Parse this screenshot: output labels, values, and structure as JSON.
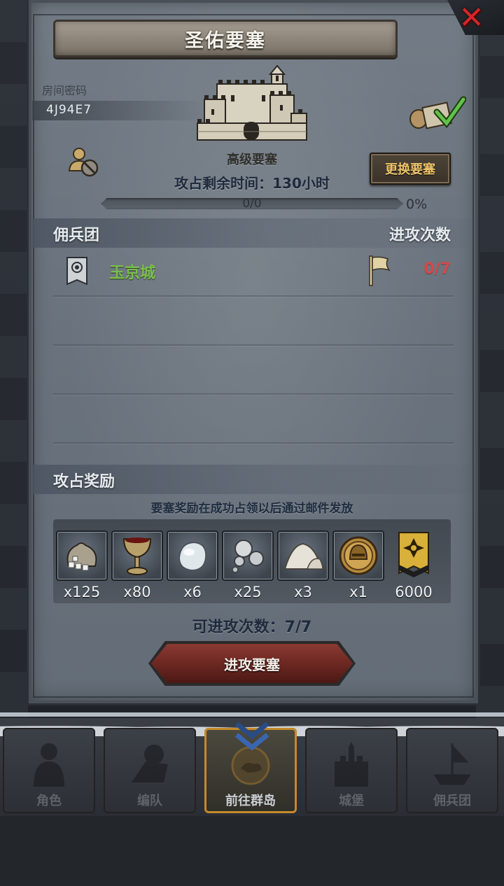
{
  "dialog": {
    "title": "圣佑要塞",
    "room_label": "房间密码",
    "room_code": "4J94E7",
    "fortress_name": "高级要塞",
    "change_button": "更换要塞",
    "time_remaining": "攻占剩余时间：130小时",
    "progress_text": "0/0",
    "progress_percent": "0%",
    "progress_value": 0
  },
  "mercenary_section": {
    "left_label": "佣兵团",
    "right_label": "进攻次数",
    "rows": [
      {
        "name": "玉京城",
        "attacks": "0/7"
      }
    ]
  },
  "rewards_section": {
    "label": "攻占奖励",
    "note": "要塞奖励在成功占领以后通过邮件发放",
    "items": [
      {
        "icon": "gem-sack-icon",
        "count": "x125"
      },
      {
        "icon": "goblet-icon",
        "count": "x80"
      },
      {
        "icon": "pearl-stone-icon",
        "count": "x6"
      },
      {
        "icon": "silver-orbs-icon",
        "count": "x25"
      },
      {
        "icon": "salt-pile-icon",
        "count": "x3"
      },
      {
        "icon": "knight-helmet-coin-icon",
        "count": "x1"
      },
      {
        "icon": "honor-badge-icon",
        "count": "6000"
      }
    ],
    "remaining_attacks": "可进攻次数：7/7",
    "attack_button": "进攻要塞"
  },
  "bottom_nav": [
    {
      "label": "角色",
      "icon": "knight-icon",
      "active": false
    },
    {
      "label": "编队",
      "icon": "formation-icon",
      "active": false
    },
    {
      "label": "前往群岛",
      "icon": "island-compass-icon",
      "active": true
    },
    {
      "label": "城堡",
      "icon": "castle-icon",
      "active": false
    },
    {
      "label": "佣兵团",
      "icon": "mercenary-ship-icon",
      "active": false
    }
  ],
  "colors": {
    "panel": "#6b747e",
    "merc_name": "#79c04a",
    "attack_count": "#d5484a",
    "change_button_text": "#f0c46a",
    "close": "#d1262a"
  }
}
